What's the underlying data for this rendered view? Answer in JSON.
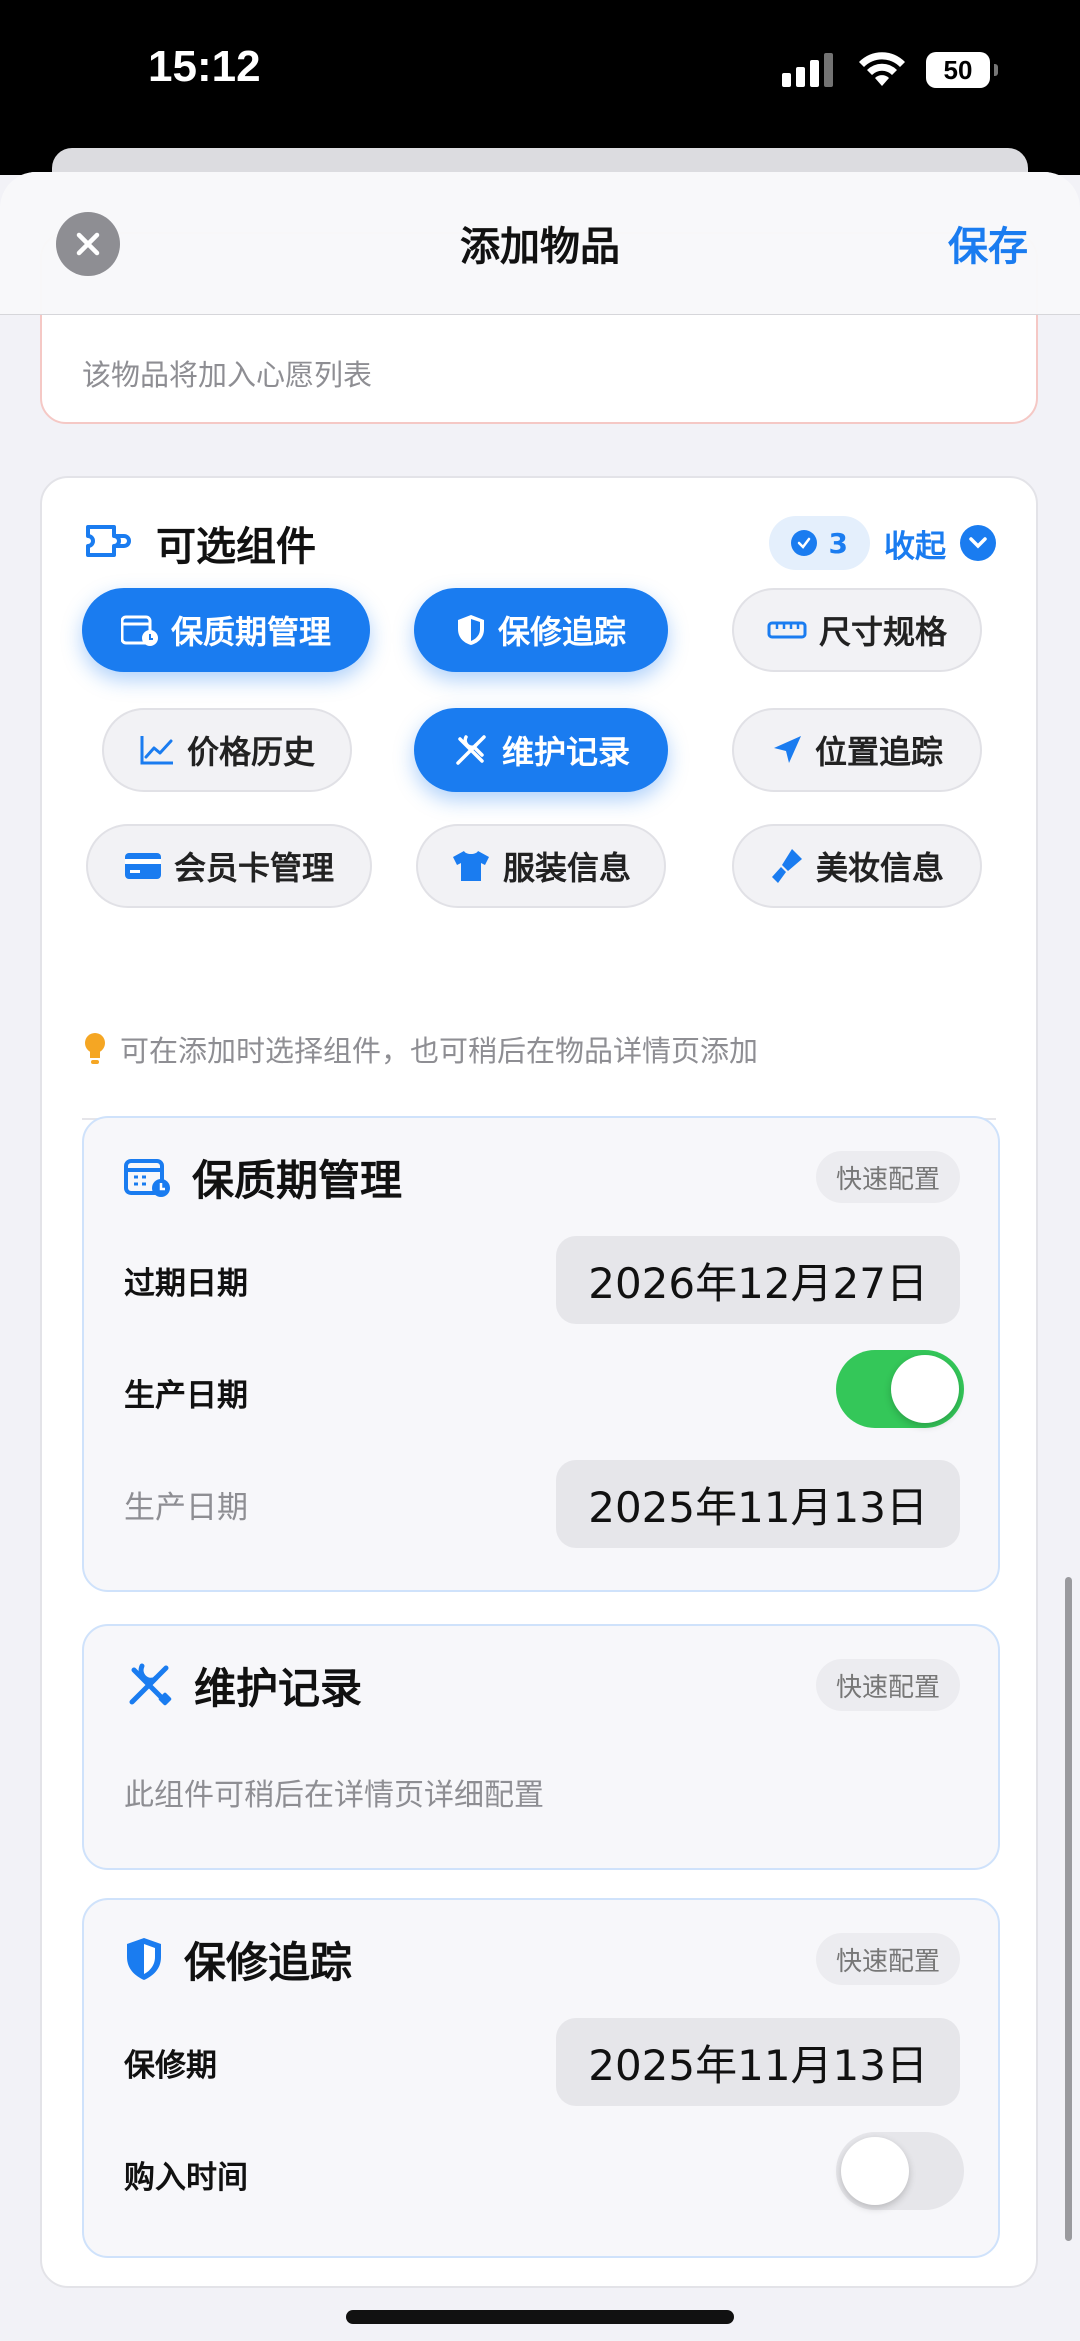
{
  "status": {
    "time": "15:12",
    "battery": "50"
  },
  "nav": {
    "title": "添加物品",
    "save": "保存"
  },
  "wishlist_note": "该物品将加入心愿列表",
  "optional": {
    "title": "可选组件",
    "count": "3",
    "collapse": "收起",
    "chips": [
      {
        "label": "保质期管理",
        "icon": "calendar-clock-icon",
        "selected": true
      },
      {
        "label": "保修追踪",
        "icon": "shield-icon",
        "selected": true
      },
      {
        "label": "尺寸规格",
        "icon": "ruler-icon",
        "selected": false
      },
      {
        "label": "价格历史",
        "icon": "trend-chart-icon",
        "selected": false
      },
      {
        "label": "维护记录",
        "icon": "tools-icon",
        "selected": true
      },
      {
        "label": "位置追踪",
        "icon": "location-arrow-icon",
        "selected": false
      },
      {
        "label": "会员卡管理",
        "icon": "credit-card-icon",
        "selected": false
      },
      {
        "label": "服装信息",
        "icon": "tshirt-icon",
        "selected": false
      },
      {
        "label": "美妆信息",
        "icon": "makeup-brush-icon",
        "selected": false
      }
    ],
    "tip": "可在添加时选择组件，也可稍后在物品详情页添加"
  },
  "shelf_life": {
    "title": "保质期管理",
    "quick": "快速配置",
    "expiry_label": "过期日期",
    "expiry_value": "2026年12月27日",
    "production_toggle_label": "生产日期",
    "production_toggle_on": true,
    "production_label": "生产日期",
    "production_value": "2025年11月13日"
  },
  "maintenance": {
    "title": "维护记录",
    "quick": "快速配置",
    "note": "此组件可稍后在详情页详细配置"
  },
  "warranty": {
    "title": "保修追踪",
    "quick": "快速配置",
    "period_label": "保修期",
    "period_value": "2025年11月13日",
    "purchase_label": "购入时间",
    "purchase_toggle_on": false
  },
  "colors": {
    "accent": "#1a7cf0",
    "toggle_on": "#34c759"
  }
}
